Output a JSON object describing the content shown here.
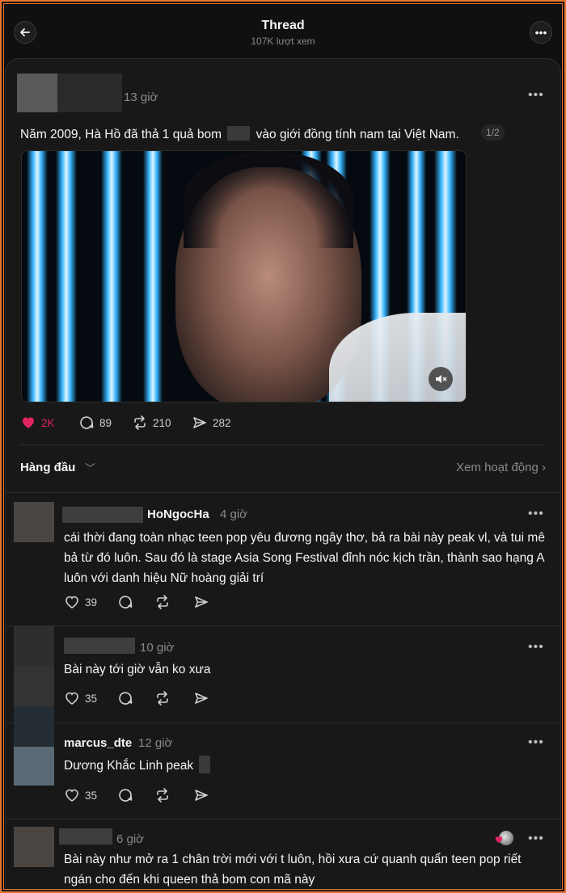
{
  "header": {
    "title": "Thread",
    "views": "107K lượt xem"
  },
  "post": {
    "time": "13 giờ",
    "text_before": "Năm 2009, Hà Hồ đã thả 1 quả bom",
    "text_after": "vào giới đồng tính nam tại Việt Nam.",
    "pager": "1/2",
    "likes": "2K",
    "replies": "89",
    "reposts": "210",
    "shares": "282"
  },
  "sort": {
    "label": "Hàng đầu",
    "activity": "Xem hoạt động"
  },
  "comments": [
    {
      "name": "HoNgocHa",
      "time": "4 giờ",
      "text": "cái thời đang toàn nhạc teen pop yêu đương ngây thơ, bả ra bài này peak vl, và tui mê bả từ đó luôn. Sau đó là stage Asia Song Festival đỉnh nóc kịch trần, thành sao hạng A luôn với danh hiệu Nữ hoàng giải trí",
      "likes": "39"
    },
    {
      "name": "",
      "time": "10 giờ",
      "text": "Bài này tới giờ vẫn ko xưa",
      "likes": "35"
    },
    {
      "name": "marcus_dte",
      "time": "12 giờ",
      "text": "Dương Khắc Linh peak",
      "likes": "35"
    },
    {
      "name": "",
      "time": "6 giờ",
      "text": "Bài này như mở ra 1 chân trời mới với t luôn, hồi xưa cứ quanh quẩn teen pop riết ngán cho đến khi queen thả bom con mã này",
      "likes": ""
    }
  ],
  "colors": {
    "background": "#101010",
    "card": "#181818",
    "like": "#e0245e",
    "muted": "#8a8a8a",
    "frame": "#e8742c"
  }
}
